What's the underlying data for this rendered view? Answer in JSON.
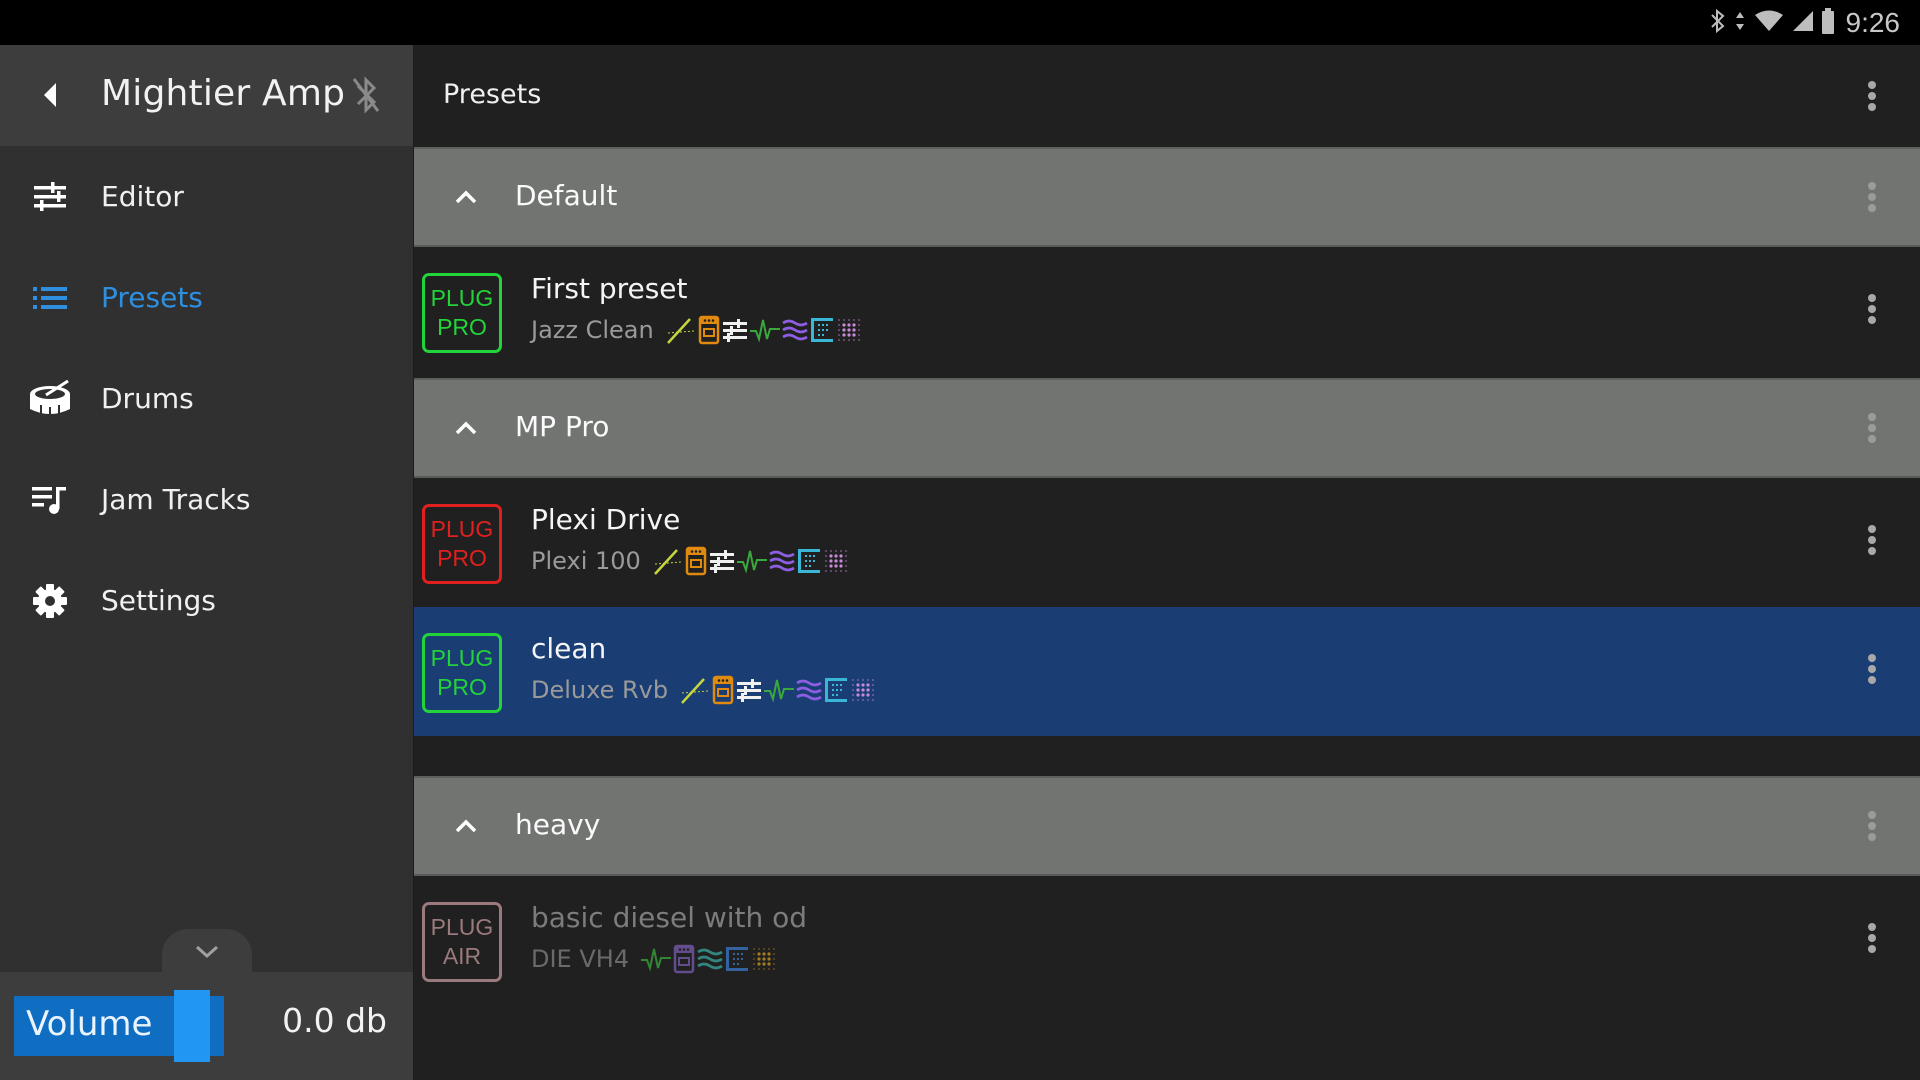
{
  "status_bar": {
    "icons": [
      "bluetooth-icon",
      "data-arrows-icon",
      "wifi-icon",
      "cell-signal-icon",
      "battery-icon"
    ],
    "time": "9:26"
  },
  "sidebar": {
    "title": "Mightier Amp",
    "back_icon": "back-triangle-icon",
    "bluetooth_icon": "bluetooth-disabled-icon",
    "items": [
      {
        "label": "Editor",
        "icon": "sliders-icon",
        "active": false
      },
      {
        "label": "Presets",
        "icon": "list-icon",
        "active": true
      },
      {
        "label": "Drums",
        "icon": "drum-icon",
        "active": false
      },
      {
        "label": "Jam Tracks",
        "icon": "playlist-music-icon",
        "active": false
      },
      {
        "label": "Settings",
        "icon": "gear-icon",
        "active": false
      }
    ],
    "collapse_icon": "chevron-down-icon",
    "volume": {
      "label": "Volume",
      "value": "0.0 db"
    }
  },
  "main": {
    "title": "Presets",
    "accent_color": "#2e8fe0",
    "selected_row_color": "#1a3d74",
    "groups": [
      {
        "title": "Default",
        "expanded": true,
        "presets": [
          {
            "name": "First preset",
            "amp": "Jazz Clean",
            "badge": [
              "PLUG",
              "PRO"
            ],
            "badge_color": "#22d43a",
            "selected": false,
            "disabled": false,
            "effects": [
              "noise-gate",
              "compressor",
              "eq",
              "modulation",
              "delay",
              "reverb",
              "cabinet"
            ]
          }
        ]
      },
      {
        "title": "MP Pro",
        "expanded": true,
        "presets": [
          {
            "name": "Plexi Drive",
            "amp": "Plexi 100",
            "badge": [
              "PLUG",
              "PRO"
            ],
            "badge_color": "#e0201e",
            "selected": false,
            "disabled": false,
            "effects": [
              "noise-gate",
              "compressor",
              "eq",
              "modulation",
              "delay",
              "reverb",
              "cabinet"
            ]
          },
          {
            "name": "clean",
            "amp": "Deluxe Rvb",
            "badge": [
              "PLUG",
              "PRO"
            ],
            "badge_color": "#22d43a",
            "selected": true,
            "disabled": false,
            "effects": [
              "noise-gate",
              "compressor",
              "eq",
              "modulation",
              "delay",
              "reverb",
              "cabinet"
            ]
          }
        ]
      },
      {
        "title": "heavy",
        "expanded": true,
        "presets": [
          {
            "name": "basic diesel with od",
            "amp": "DIE VH4",
            "badge": [
              "PLUG",
              "AIR"
            ],
            "badge_color": "#9a7a7c",
            "selected": false,
            "disabled": true,
            "effects": [
              "modulation",
              "compressor",
              "delay",
              "reverb",
              "cabinet"
            ]
          }
        ]
      }
    ]
  }
}
